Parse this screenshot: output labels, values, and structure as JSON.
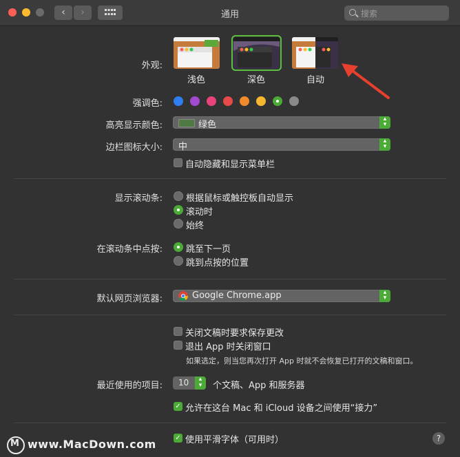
{
  "window": {
    "title": "通用",
    "search_placeholder": "搜索"
  },
  "appearance": {
    "label": "外观:",
    "options": [
      {
        "name": "浅色",
        "selected": false
      },
      {
        "name": "深色",
        "selected": true
      },
      {
        "name": "自动",
        "selected": false
      }
    ]
  },
  "accent": {
    "label": "强调色:",
    "colors": [
      "#2f7ef0",
      "#a24bd1",
      "#e8437b",
      "#e84a4a",
      "#f08a2a",
      "#f5b72d",
      "#4caa37",
      "#8a8a8a"
    ],
    "selected_index": 6
  },
  "highlight": {
    "label": "高亮显示颜色:",
    "value": "绿色",
    "swatch_color": "#4f7a44"
  },
  "sidebar_icon": {
    "label": "边栏图标大小:",
    "value": "中"
  },
  "auto_hide_menu": {
    "label": "自动隐藏和显示菜单栏",
    "checked": false
  },
  "scrollbars": {
    "label": "显示滚动条:",
    "options": [
      {
        "label": "根据鼠标或触控板自动显示",
        "selected": false
      },
      {
        "label": "滚动时",
        "selected": true
      },
      {
        "label": "始终",
        "selected": false
      }
    ]
  },
  "click_scroll": {
    "label": "在滚动条中点按:",
    "options": [
      {
        "label": "跳至下一页",
        "selected": true
      },
      {
        "label": "跳到点按的位置",
        "selected": false
      }
    ]
  },
  "browser": {
    "label": "默认网页浏览器:",
    "value": "Google Chrome.app"
  },
  "ask_save": {
    "label": "关闭文稿时要求保存更改",
    "checked": false
  },
  "close_windows": {
    "label": "退出 App 时关闭窗口",
    "checked": false
  },
  "close_windows_note": "如果选定，则当您再次打开 App 时就不会恢复已打开的文稿和窗口。",
  "recent": {
    "label": "最近使用的项目:",
    "value": "10",
    "suffix": "个文稿、App 和服务器"
  },
  "handoff": {
    "label": "允许在这台 Mac 和 iCloud 设备之间使用“接力”",
    "checked": true
  },
  "font_smoothing": {
    "label": "使用平滑字体（可用时）",
    "checked": true
  },
  "help_symbol": "?",
  "watermark": {
    "logo_letter": "M",
    "text": "www.MacDown.com"
  },
  "annotation_arrow_color": "#e8402e"
}
